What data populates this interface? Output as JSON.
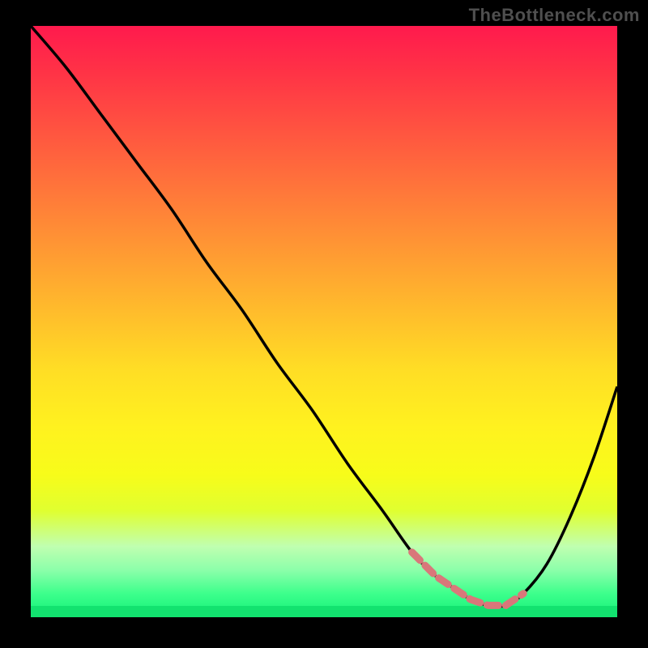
{
  "watermark": "TheBottleneck.com",
  "chart_data": {
    "type": "line",
    "title": "",
    "xlabel": "",
    "ylabel": "",
    "xlim": [
      0,
      100
    ],
    "ylim": [
      0,
      100
    ],
    "grid": false,
    "series": [
      {
        "name": "bottleneck-curve",
        "x": [
          0,
          6,
          12,
          18,
          24,
          30,
          36,
          42,
          48,
          54,
          60,
          65,
          69,
          72,
          75,
          78,
          81,
          84,
          88,
          92,
          96,
          100
        ],
        "values": [
          100,
          93,
          85,
          77,
          69,
          60,
          52,
          43,
          35,
          26,
          18,
          11,
          7,
          5,
          3,
          2,
          2,
          4,
          9,
          17,
          27,
          39
        ]
      }
    ],
    "annotations": [
      {
        "name": "optimal-band",
        "x_start": 63,
        "x_end": 82,
        "style": "pink-dash"
      }
    ],
    "background_gradient": {
      "top": "#ff1a4d",
      "middle": "#ffdd25",
      "bottom": "#12e26f"
    }
  }
}
